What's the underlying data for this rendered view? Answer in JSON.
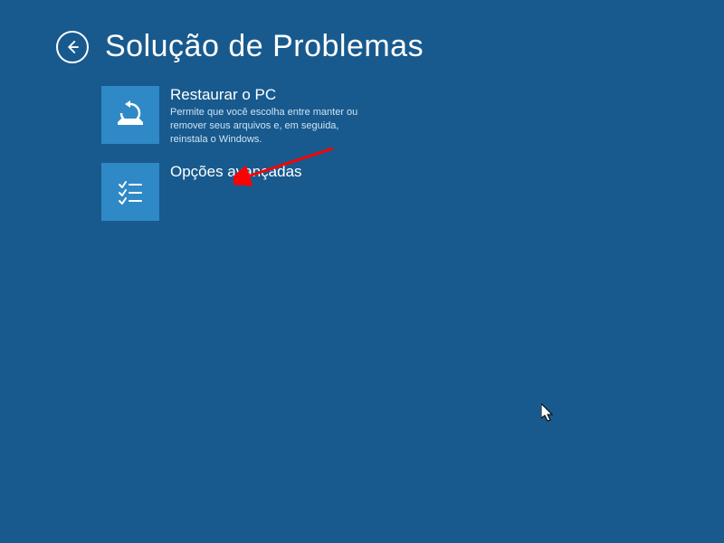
{
  "header": {
    "title": "Solução de Problemas"
  },
  "options": [
    {
      "title": "Restaurar o PC",
      "description": "Permite que você escolha entre manter ou remover seus arquivos e, em seguida, reinstala o Windows."
    },
    {
      "title": "Opções avançadas",
      "description": ""
    }
  ]
}
